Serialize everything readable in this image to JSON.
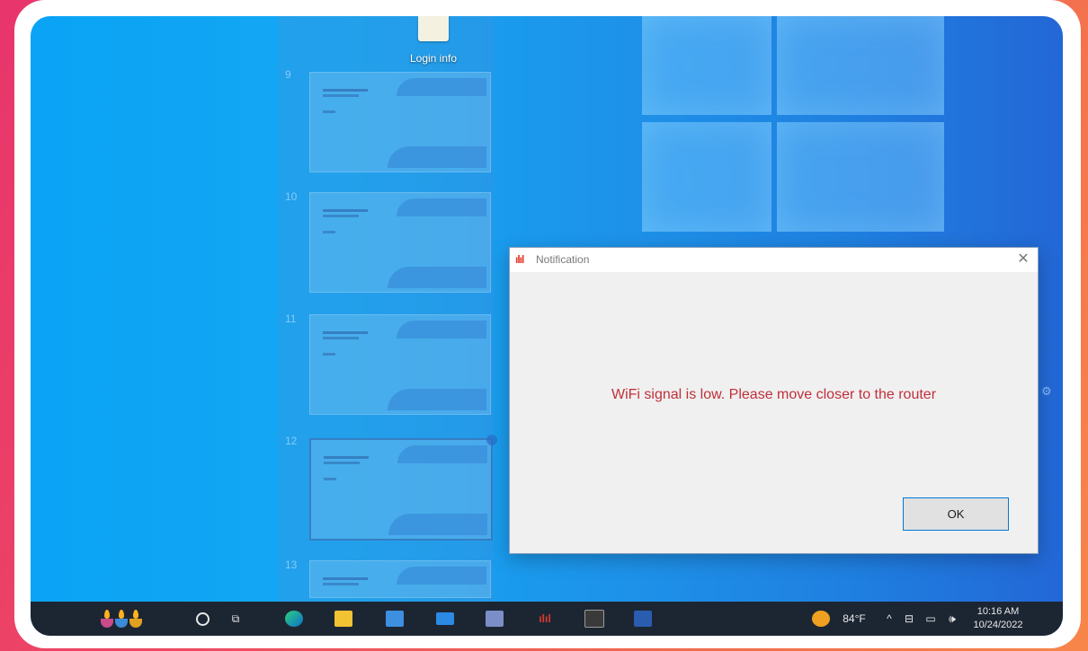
{
  "desktop": {
    "icon_label": "Login info"
  },
  "slides": [
    {
      "number": "9"
    },
    {
      "number": "10"
    },
    {
      "number": "11"
    },
    {
      "number": "12"
    },
    {
      "number": "13"
    }
  ],
  "dialog": {
    "title": "Notification",
    "title_icon": "ılıl",
    "message": "WiFi signal is low. Please move closer to the router",
    "ok_label": "OK",
    "close_glyph": "✕",
    "message_color": "#c0303a"
  },
  "taskbar": {
    "weather": "84°F",
    "time": "10:16 AM",
    "date": "10/24/2022",
    "chevron": "^",
    "volume": "🕪",
    "icons": [
      "diwali-icon",
      "search-icon",
      "task-view-icon",
      "edge-icon",
      "file-explorer-icon",
      "store-icon",
      "mail-icon",
      "remote-desktop-icon",
      "wifi-app-icon",
      "terminal-icon",
      "powershell-icon",
      "weather-icon",
      "network-icon",
      "display-icon",
      "volume-icon"
    ]
  }
}
